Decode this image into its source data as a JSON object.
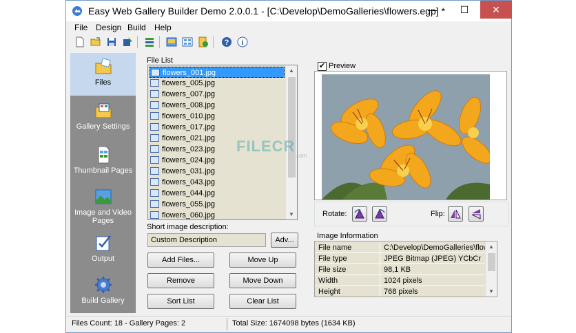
{
  "window": {
    "title": "Easy Web Gallery Builder Demo 2.0.0.1 - [C:\\Develop\\DemoGalleries\\flowers.egp] *",
    "minimize": "—",
    "maximize": "☐",
    "close": "✕"
  },
  "menu": [
    "File",
    "Design",
    "Build",
    "Help"
  ],
  "toolbar": {
    "icons": [
      "new-icon",
      "open-icon",
      "save-icon",
      "save-as-icon",
      "settings-icon",
      "preview-icon",
      "gallery-icon",
      "publish-icon",
      "help-icon",
      "info-icon"
    ]
  },
  "nav": [
    {
      "label": "Files",
      "icon": "files-folder-icon"
    },
    {
      "label": "Gallery Settings",
      "icon": "gallery-settings-icon"
    },
    {
      "label": "Thumbnail Pages",
      "icon": "thumbnail-pages-icon"
    },
    {
      "label": "Image and Video Pages",
      "icon": "image-video-pages-icon"
    },
    {
      "label": "Output",
      "icon": "output-icon"
    },
    {
      "label": "Build Gallery",
      "icon": "build-gallery-icon"
    }
  ],
  "file_list": {
    "label": "File List",
    "selected_index": 0,
    "items": [
      "flowers_001.jpg",
      "flowers_005.jpg",
      "flowers_007.jpg",
      "flowers_008.jpg",
      "flowers_010.jpg",
      "flowers_017.jpg",
      "flowers_021.jpg",
      "flowers_023.jpg",
      "flowers_024.jpg",
      "flowers_031.jpg",
      "flowers_043.jpg",
      "flowers_044.jpg",
      "flowers_055.jpg",
      "flowers_060.jpg"
    ]
  },
  "description": {
    "label": "Short image description:",
    "value": "Custom Description",
    "adv_button": "Adv..."
  },
  "buttons": {
    "add_files": "Add Files...",
    "move_up": "Move Up",
    "remove": "Remove",
    "move_down": "Move Down",
    "sort_list": "Sort List",
    "clear_list": "Clear List"
  },
  "preview": {
    "label": "Preview",
    "checked": true,
    "check_mark": "✔"
  },
  "rotate": {
    "rotate_label": "Rotate:",
    "flip_label": "Flip:"
  },
  "image_info": {
    "label": "Image Information",
    "rows": [
      {
        "key": "File name",
        "value": "C:\\Develop\\DemoGalleries\\flow..."
      },
      {
        "key": "File type",
        "value": "JPEG Bitmap (JPEG) YCbCr"
      },
      {
        "key": "File size",
        "value": "98,1 KB"
      },
      {
        "key": "Width",
        "value": "1024 pixels"
      },
      {
        "key": "Height",
        "value": "768 pixels"
      }
    ]
  },
  "status": {
    "files_count": "Files Count: 18 - Gallery Pages: 2",
    "total_size": "Total Size: 1674098 bytes (1634 KB)"
  },
  "watermark": {
    "text": "FILECR",
    "sub": ".com"
  },
  "colors": {
    "accent": "#3399ff",
    "nav_bg": "#8c8c8c",
    "list_bg": "#e6e2d2",
    "close_red": "#c75050"
  }
}
